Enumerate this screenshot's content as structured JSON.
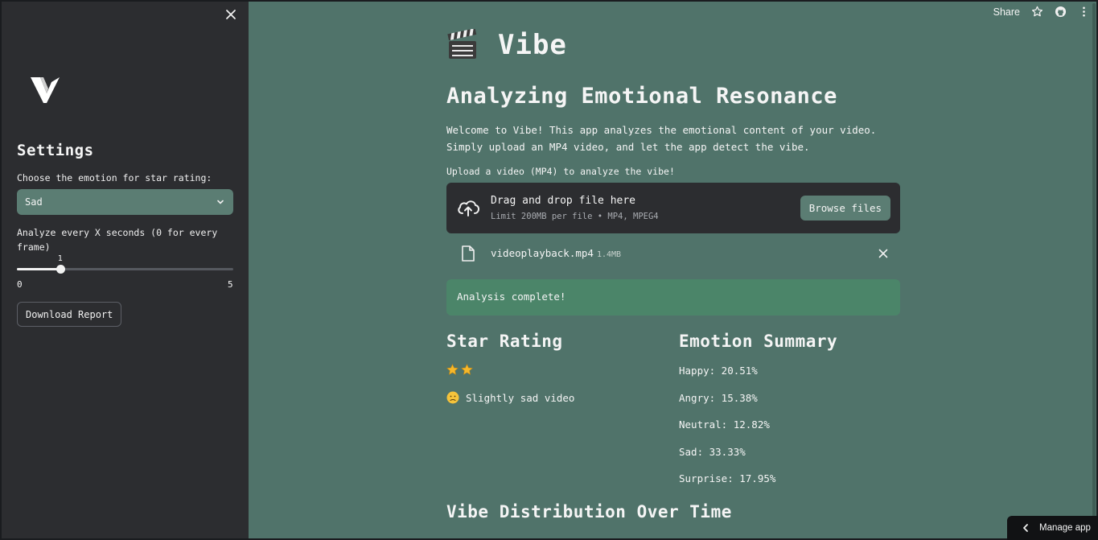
{
  "sidebar": {
    "settings_title": "Settings",
    "emotion_label": "Choose the emotion for star rating:",
    "emotion_selected": "Sad",
    "interval_label": "Analyze every X seconds (0 for every frame)",
    "slider": {
      "value": 1,
      "min": 0,
      "max": 5,
      "value_text": "1",
      "min_text": "0",
      "max_text": "5"
    },
    "download_label": "Download Report"
  },
  "toolbar": {
    "share_label": "Share"
  },
  "main": {
    "app_title": "Vibe",
    "heading": "Analyzing Emotional Resonance",
    "intro_line1": "Welcome to Vibe! This app analyzes the emotional content of your video.",
    "intro_line2": "Simply upload an MP4 video, and let the app detect the vibe.",
    "upload_label": "Upload a video (MP4) to analyze the vibe!",
    "dropzone": {
      "title": "Drag and drop file here",
      "subtitle": "Limit 200MB per file • MP4, MPEG4",
      "browse_label": "Browse files"
    },
    "file": {
      "name": "videoplayback.mp4",
      "size": "1.4MB"
    },
    "alert": "Analysis complete!",
    "star_rating": {
      "heading": "Star Rating",
      "stars": 2,
      "verdict": "Slightly sad video"
    },
    "emotion_summary": {
      "heading": "Emotion Summary",
      "items": [
        "Happy: 20.51%",
        "Angry: 15.38%",
        "Neutral: 12.82%",
        "Sad: 33.33%",
        "Surprise: 17.95%"
      ]
    },
    "distribution_heading": "Vibe Distribution Over Time"
  },
  "manage_app": "Manage app",
  "colors": {
    "background": "#50736a",
    "sidebar": "#2c2d30",
    "accent": "#5b7d73",
    "success": "#4b8569"
  }
}
